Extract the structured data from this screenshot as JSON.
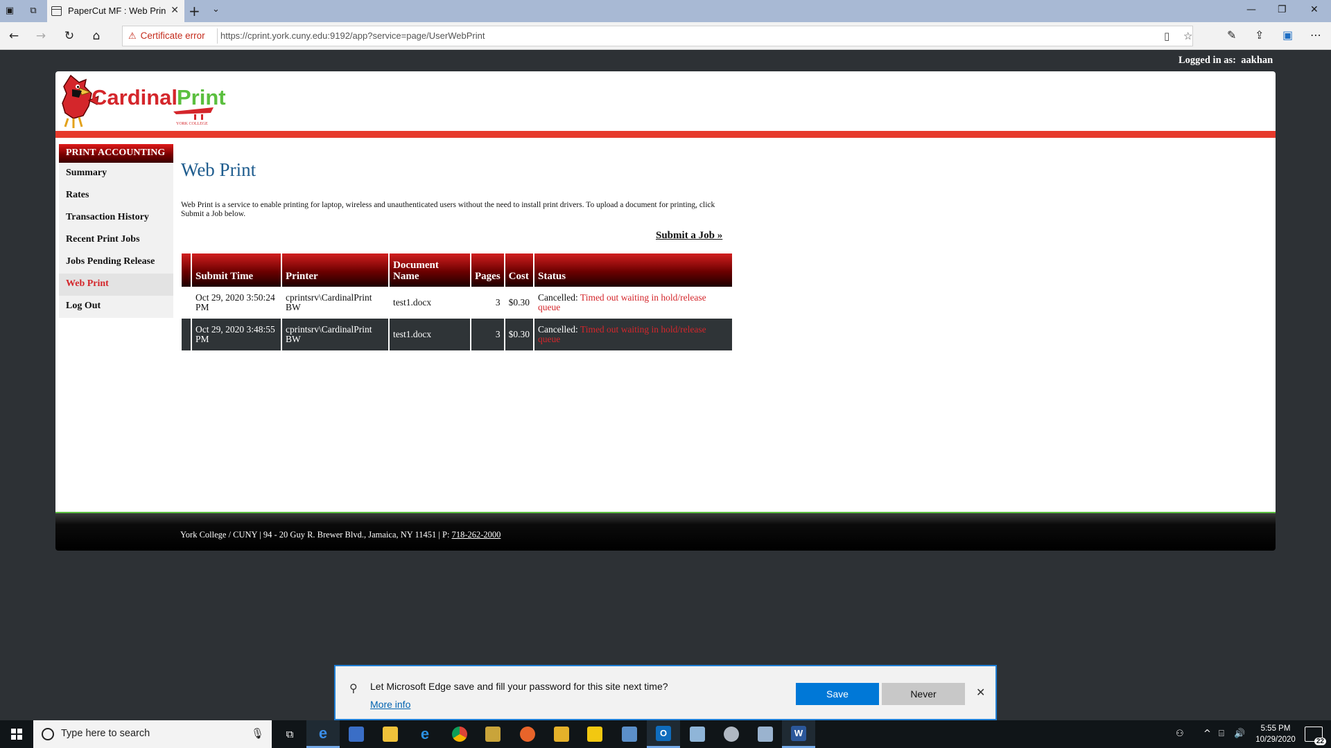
{
  "browser": {
    "tab_title": "PaperCut MF : Web Prin",
    "new_tab": "+",
    "cert_error": "Certificate error",
    "url": "https://cprint.york.cuny.edu:9192/app?service=page/UserWebPrint"
  },
  "header": {
    "logged_in_label": "Logged in as:",
    "username": "aakhan",
    "logo_text_part1": "Cardinal",
    "logo_text_part2": "Print",
    "logo_subtext": "YORK COLLEGE"
  },
  "sidebar": {
    "heading": "PRINT ACCOUNTING",
    "items": [
      {
        "label": "Summary",
        "active": false
      },
      {
        "label": "Rates",
        "active": false
      },
      {
        "label": "Transaction History",
        "active": false
      },
      {
        "label": "Recent Print Jobs",
        "active": false
      },
      {
        "label": "Jobs Pending Release",
        "active": false
      },
      {
        "label": "Web Print",
        "active": true
      },
      {
        "label": "Log Out",
        "active": false
      }
    ]
  },
  "main": {
    "title": "Web Print",
    "intro": "Web Print is a service to enable printing for laptop, wireless and unauthenticated users without the need to install print drivers. To upload a document for printing, click Submit a Job below.",
    "submit_link": "Submit a Job »",
    "table": {
      "columns": [
        "Submit Time",
        "Printer",
        "Document Name",
        "Pages",
        "Cost",
        "Status"
      ],
      "rows": [
        {
          "submit_time": "Oct 29, 2020 3:50:24 PM",
          "printer": "cprintsrv\\CardinalPrint BW",
          "document": "test1.docx",
          "pages": "3",
          "cost": "$0.30",
          "status": "Cancelled:",
          "status_reason": "Timed out waiting in hold/release queue"
        },
        {
          "submit_time": "Oct 29, 2020 3:48:55 PM",
          "printer": "cprintsrv\\CardinalPrint BW",
          "document": "test1.docx",
          "pages": "3",
          "cost": "$0.30",
          "status": "Cancelled:",
          "status_reason": "Timed out waiting in hold/release queue"
        }
      ]
    }
  },
  "footer": {
    "address": "York College / CUNY | 94 - 20 Guy R. Brewer Blvd., Jamaica, NY 11451 | P:",
    "phone": "718-262-2000"
  },
  "password_prompt": {
    "message": "Let Microsoft Edge save and fill your password for this site next time?",
    "more_info": "More info",
    "save": "Save",
    "never": "Never"
  },
  "taskbar": {
    "search_placeholder": "Type here to search",
    "time": "5:55 PM",
    "date": "10/29/2020",
    "notification_count": "22"
  },
  "colors": {
    "brand_red": "#e6392b",
    "brand_green": "#5bbf3f",
    "title_blue": "#1e5c8e",
    "edge_blue": "#0078d7"
  }
}
